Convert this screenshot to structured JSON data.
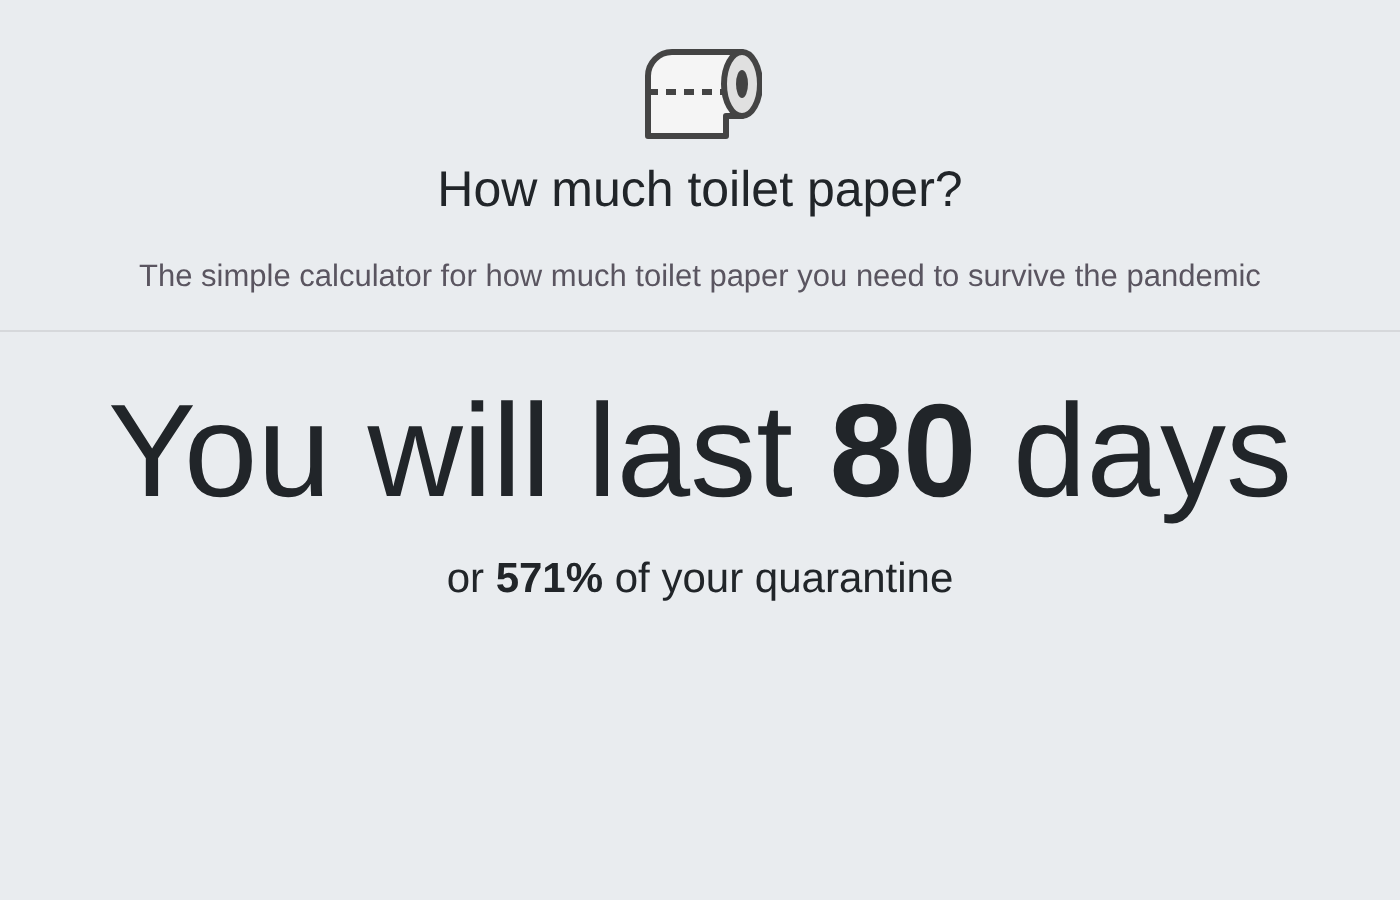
{
  "header": {
    "title": "How much toilet paper?",
    "subtitle": "The simple calculator for how much toilet paper you need to survive the pandemic"
  },
  "result": {
    "headline": "You will last **80** days",
    "detail": "or **571%** of your quarantine"
  }
}
